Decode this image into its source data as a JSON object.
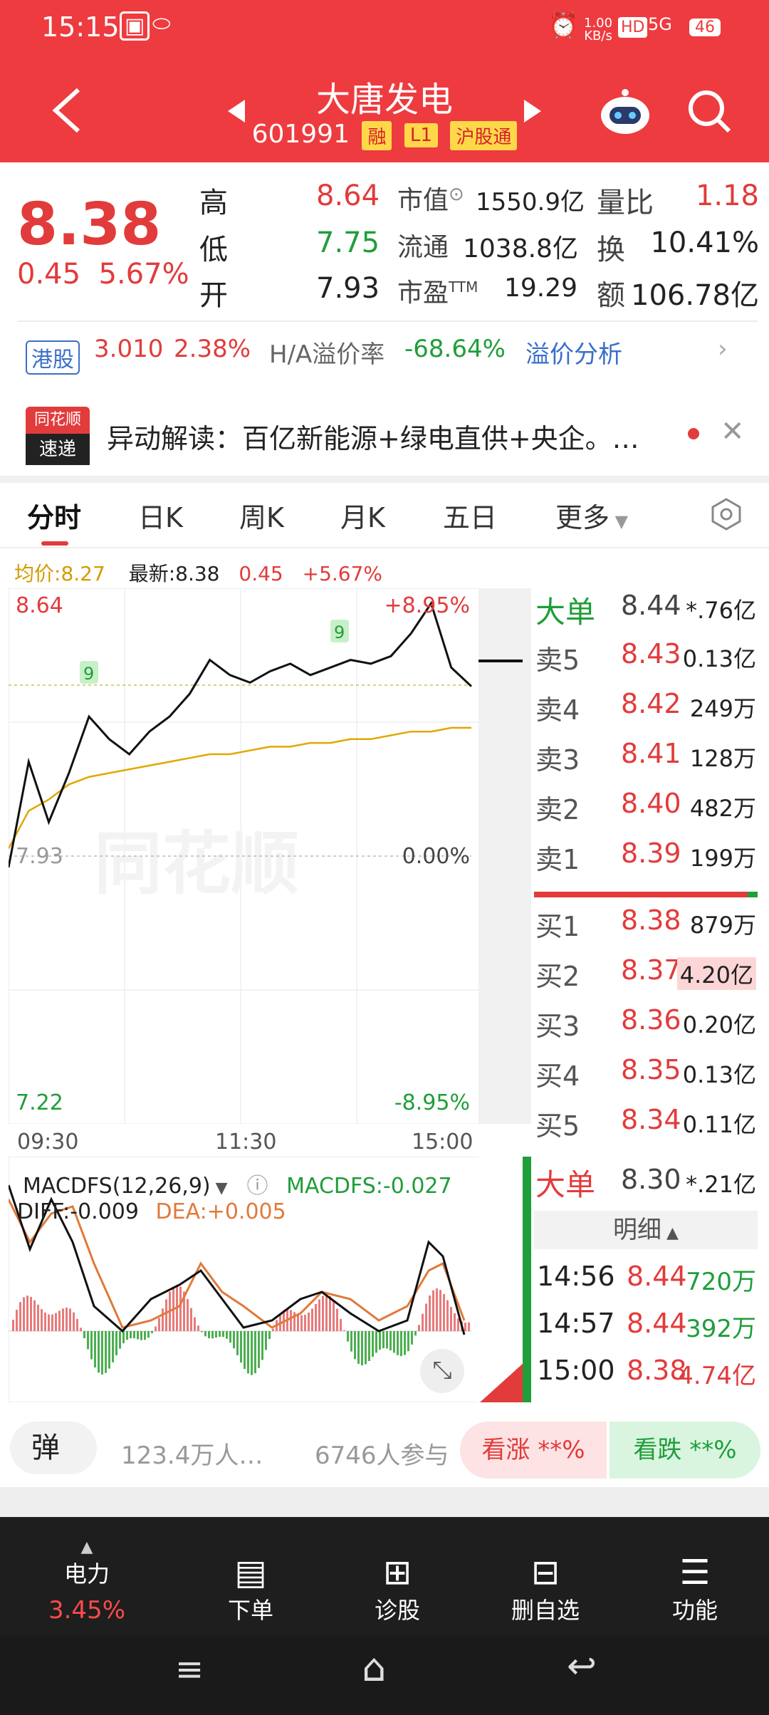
{
  "status": {
    "time": "15:15",
    "speed_value": "1.00",
    "speed_unit": "KB/s",
    "hd": "HD",
    "net": "5G",
    "battery": "46"
  },
  "header": {
    "title": "大唐发电",
    "code": "601991",
    "tags": [
      "融",
      "L1",
      "沪股通"
    ]
  },
  "quote": {
    "price": "8.38",
    "change": "0.45",
    "change_pct": "5.67%",
    "high_label": "高",
    "high": "8.64",
    "low_label": "低",
    "low": "7.75",
    "open_label": "开",
    "open": "7.93",
    "mcap_label": "市值",
    "mcap": "1550.9亿",
    "float_label": "流通",
    "float": "1038.8亿",
    "pe_label": "市盈",
    "pe_sup": "TTM",
    "pe": "19.29",
    "vr_label": "量比",
    "vr": "1.18",
    "turn_label": "换",
    "turn": "10.41%",
    "amt_label": "额",
    "amt": "106.78亿"
  },
  "hk": {
    "tag": "港股",
    "price": "3.010",
    "pct": "2.38%",
    "prem_label": "H/A溢价率",
    "prem": "-68.64%",
    "link": "溢价分析"
  },
  "news": {
    "logo_top": "同花顺",
    "logo_bottom": "速递",
    "text": "异动解读：百亿新能源+绿电直供+央企。…"
  },
  "tabs": [
    "分时",
    "日K",
    "周K",
    "月K",
    "五日",
    "更多"
  ],
  "chart_info": {
    "avg_label": "均价:",
    "avg": "8.27",
    "latest_label": "最新:",
    "latest": "8.38",
    "chg": "0.45",
    "pct": "+5.67%"
  },
  "chart_data": {
    "type": "line",
    "y_left": [
      "8.64",
      "7.93",
      "7.22"
    ],
    "y_right": [
      "+8.95%",
      "0.00%",
      "-8.95%"
    ],
    "x_labels": [
      "09:30",
      "11:30",
      "15:00"
    ],
    "ylim": [
      7.22,
      8.64
    ],
    "series": [
      {
        "values": [
          7.9,
          8.18,
          8.02,
          8.15,
          8.3,
          8.24,
          8.2,
          8.26,
          8.3,
          8.36,
          8.45,
          8.41,
          8.39,
          8.42,
          8.44,
          8.41,
          8.43,
          8.45,
          8.44,
          8.46,
          8.52,
          8.6,
          8.43,
          8.38
        ]
      },
      {
        "values": [
          7.95,
          8.05,
          8.08,
          8.12,
          8.14,
          8.15,
          8.16,
          8.17,
          8.18,
          8.19,
          8.2,
          8.2,
          8.21,
          8.22,
          8.22,
          8.23,
          8.23,
          8.24,
          8.24,
          8.25,
          8.26,
          8.26,
          8.27,
          8.27
        ]
      }
    ],
    "markers": [
      "9",
      "9"
    ]
  },
  "macd": {
    "title": "MACDFS(12,26,9)",
    "value_label": "MACDFS:",
    "value": "-0.027",
    "dif_label": "DIFF:",
    "dif": "-0.009",
    "dea_label": "DEA:",
    "dea": "+0.005"
  },
  "big_order_top": {
    "label": "大单",
    "price": "8.44",
    "amt": "*.76亿"
  },
  "asks": [
    {
      "label": "卖5",
      "price": "8.43",
      "vol": "0.13亿"
    },
    {
      "label": "卖4",
      "price": "8.42",
      "vol": "249万"
    },
    {
      "label": "卖3",
      "price": "8.41",
      "vol": "128万"
    },
    {
      "label": "卖2",
      "price": "8.40",
      "vol": "482万"
    },
    {
      "label": "卖1",
      "price": "8.39",
      "vol": "199万"
    }
  ],
  "bids": [
    {
      "label": "买1",
      "price": "8.38",
      "vol": "879万"
    },
    {
      "label": "买2",
      "price": "8.37",
      "vol": "4.20亿"
    },
    {
      "label": "买3",
      "price": "8.36",
      "vol": "0.20亿"
    },
    {
      "label": "买4",
      "price": "8.35",
      "vol": "0.13亿"
    },
    {
      "label": "买5",
      "price": "8.34",
      "vol": "0.11亿"
    }
  ],
  "big_order_bottom": {
    "label": "大单",
    "price": "8.30",
    "amt": "*.21亿"
  },
  "detail": {
    "header": "明细",
    "rows": [
      {
        "time": "14:56",
        "price": "8.44",
        "vol": "720万"
      },
      {
        "time": "14:57",
        "price": "8.44",
        "vol": "392万"
      },
      {
        "time": "15:00",
        "price": "8.38",
        "vol": "4.74亿"
      }
    ]
  },
  "community": {
    "barrage": "弹",
    "people": "123.4万人…",
    "participants": "6746人参与",
    "bull": "看涨 **%",
    "bear": "看跌 **%"
  },
  "toolbar": {
    "sector": "电力",
    "sector_pct": "3.45%",
    "items": [
      "下单",
      "诊股",
      "删自选",
      "功能"
    ]
  },
  "watermark": "同花顺"
}
